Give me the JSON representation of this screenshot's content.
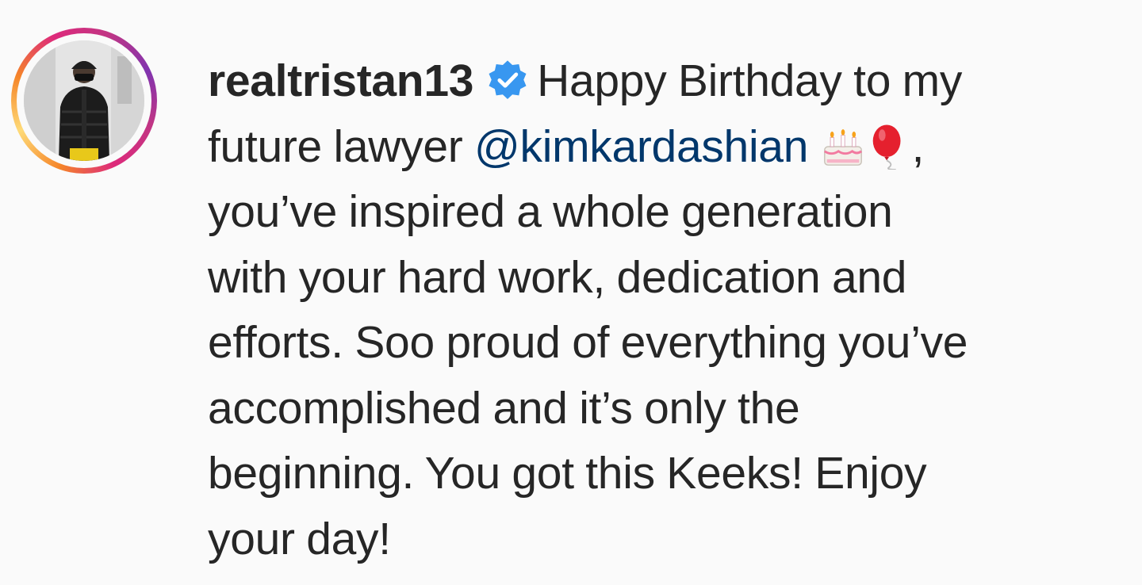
{
  "post": {
    "avatar": {
      "icon": "profile-photo",
      "ring_colors": [
        "#feda77",
        "#f58529",
        "#dd2a7b",
        "#8134af"
      ]
    },
    "username": "realtristan13",
    "verified_icon": "verified-badge-icon",
    "verified_color": "#3897f0",
    "mention_color": "#00376b",
    "caption": {
      "line1_text": "Happy Birthday to my",
      "line2_prefix": "future lawyer ",
      "mention": "@kimkardashian",
      "emojis": [
        "birthday-cake-icon",
        "balloon-icon"
      ],
      "line2_suffix": ",",
      "line3": "you’ve inspired a whole generation",
      "line4": "with your hard work, dedication and",
      "line5": "efforts. Soo proud of everything you’ve",
      "line6": "accomplished and it’s only the",
      "line7": "beginning. You got this Keeks! Enjoy",
      "line8": "your day!"
    }
  }
}
